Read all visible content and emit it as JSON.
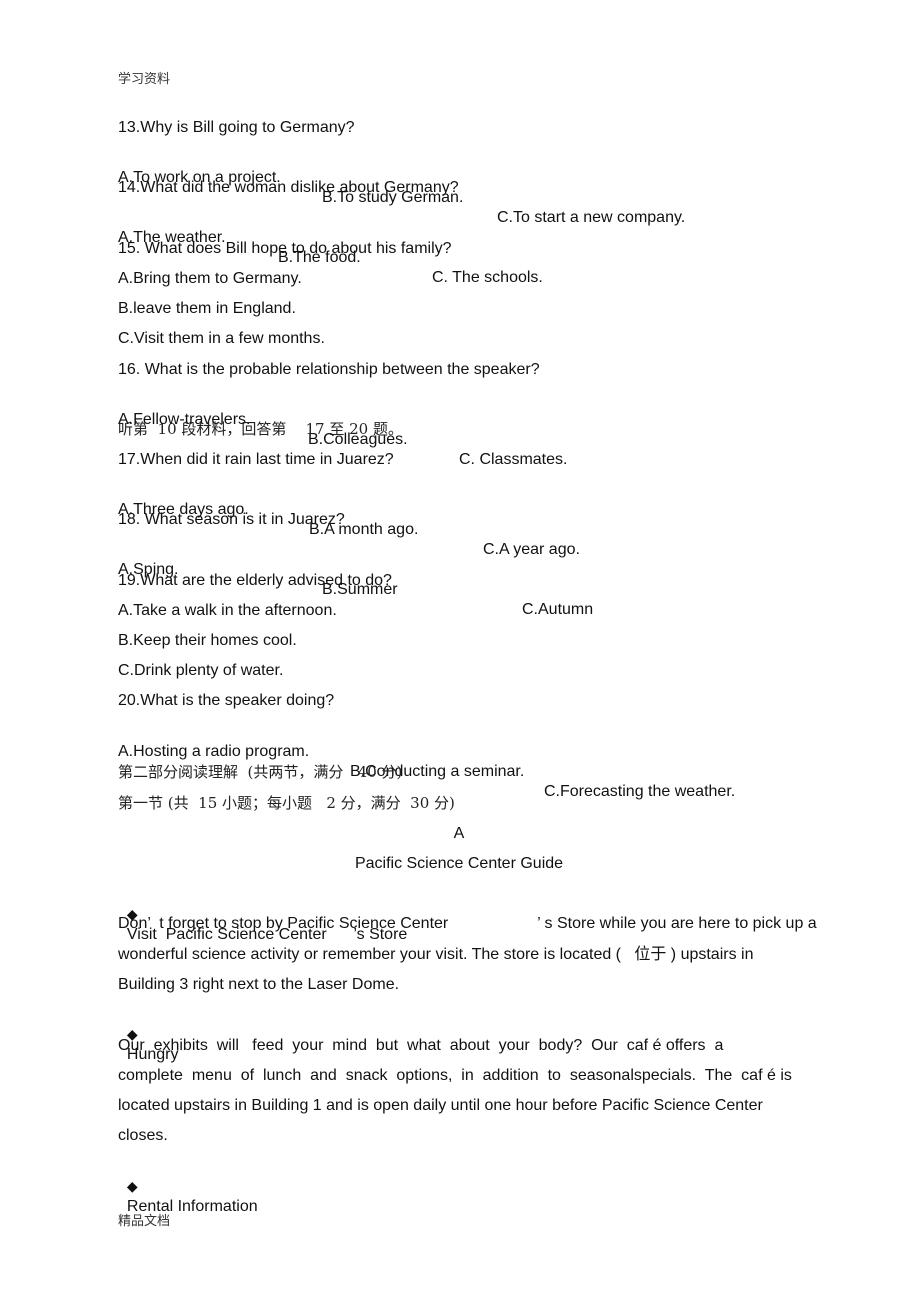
{
  "header": {
    "note": "学习资料"
  },
  "footer": {
    "note": "精品文档"
  },
  "listening": {
    "questions": [
      {
        "stem": "13.Why is Bill going to Germany?",
        "options": [
          "A.To work on a project.",
          "B.To study German.",
          "C.To start a new company."
        ]
      },
      {
        "stem": "14.What did the woman dislike about Germany?",
        "options": [
          "A.The weather.",
          "B.The food.",
          "C. The schools."
        ]
      },
      {
        "stem": "15. What does Bill hope to do about his family?",
        "options": [
          "A.Bring them to Germany.",
          "B.leave them in England.",
          "C.Visit them in a few months."
        ]
      },
      {
        "stem": "16. What is the probable relationship between the speaker?",
        "options": [
          "A.Fellow-travelers.",
          "B.Colleagues.",
          "C. Classmates."
        ]
      },
      {
        "stem": "17.When did it rain last time in Juarez?",
        "options": [
          "A.Three days ago.",
          "B.A month ago.",
          "C.A year ago."
        ]
      },
      {
        "stem": "18. What season is it in Juarez?",
        "options": [
          "A.Sping.",
          "B.Summer",
          "C.Autumn"
        ]
      },
      {
        "stem": "19.What are the elderly advised to do?",
        "options": [
          "A.Take a walk in the afternoon.",
          "B.Keep their homes cool.",
          "C.Drink plenty of water."
        ]
      },
      {
        "stem": "20.What is the speaker doing?",
        "options": [
          "A.Hosting a radio program.",
          "B.Conducting a seminar.",
          "C.Forecasting the weather."
        ]
      }
    ],
    "section10_instruction": "听第  10 段材料，回答第    17 至 20 题。"
  },
  "reading": {
    "part_title": "第二部分阅读理解  (共两节，满分   40 分)",
    "section_title": "第一节 (共  15 小题；每小题   2 分，满分  30 分)",
    "passage_label": "A",
    "passage_title": "Pacific Science Center Guide",
    "bullet_glyph": "◆",
    "sections": [
      {
        "heading": "Visit  Pacific Science Center      ’s Store",
        "lines": [
          "Don’  t forget to stop by Pacific Science Center                    ’ s Store while you are here to pick up a",
          "wonderful science activity or remember your visit. The store is located (   位于 ) upstairs in",
          "Building 3 right next to the Laser Dome."
        ]
      },
      {
        "heading": "Hungry",
        "lines": [
          "Our  exhibits  will   feed  your  mind  but  what  about  your  body?  Our  caf é offers  a",
          "complete  menu  of  lunch  and  snack  options,  in  addition  to  seasonalspecials.  The  caf é is",
          "located upstairs in Building 1 and is open daily until one hour before Pacific Science Center",
          "closes."
        ]
      },
      {
        "heading": "Rental Information",
        "lines": []
      }
    ]
  }
}
